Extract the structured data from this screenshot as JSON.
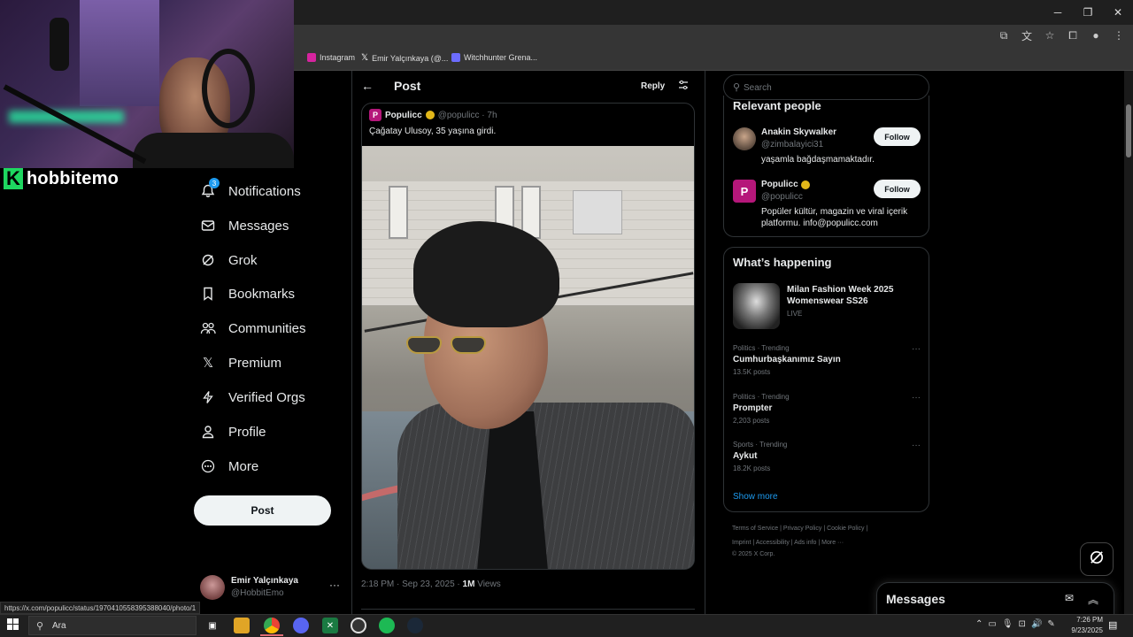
{
  "bookmarks": [
    {
      "label": "Instagram",
      "icon": "instagram-icon",
      "color": "#d6249f"
    },
    {
      "label": "Emir Yalçınkaya (@...",
      "icon": "x-logo-icon",
      "color": "#000000"
    },
    {
      "label": "Witchhunter Grena...",
      "icon": "shield-icon",
      "color": "#6c6cff"
    }
  ],
  "streamer": {
    "name": "hobbitemo",
    "logo_letter": "K"
  },
  "nav": {
    "notifications": "Notifications",
    "notifications_badge": "3",
    "messages": "Messages",
    "grok": "Grok",
    "bookmarks": "Bookmarks",
    "communities": "Communities",
    "premium": "Premium",
    "verified_orgs": "Verified Orgs",
    "profile": "Profile",
    "more": "More",
    "post_button": "Post"
  },
  "account": {
    "name": "Emir Yalçınkaya",
    "handle": "@HobbitEmo",
    "menu": "···"
  },
  "post_header": {
    "back": "←",
    "title": "Post",
    "reply": "Reply"
  },
  "quoted_post": {
    "avatar_letter": "P",
    "name": "Populicc",
    "handle_time": "@populicc · 7h",
    "text": "Çağatay Ulusoy, 35 yaşına girdi."
  },
  "post_meta": {
    "time": "2:18 PM · Sep 23, 2025 · ",
    "views_count": "1M",
    "views_label": " Views"
  },
  "search": {
    "placeholder": "Search"
  },
  "relevant": {
    "title": "Relevant people",
    "people": [
      {
        "name": "Anakin Skywalker",
        "handle": "@zimbalayici31",
        "bio": "yaşamla bağdaşmamaktadır.",
        "follow": "Follow"
      },
      {
        "name": "Populicc",
        "handle": "@populicc",
        "bio": "Popüler kültür, magazin ve viral içerik platformu. info@populicc.com",
        "follow": "Follow"
      }
    ]
  },
  "happening": {
    "title": "What’s happening",
    "featured": {
      "title": "Milan Fashion Week 2025 Womenswear SS26",
      "status": "LIVE"
    },
    "trends": [
      {
        "category": "Politics · Trending",
        "topic": "Cumhurbaşkanımız Sayın",
        "posts": "13.5K posts"
      },
      {
        "category": "Politics · Trending",
        "topic": "Prompter",
        "posts": "2,203 posts"
      },
      {
        "category": "Sports · Trending",
        "topic": "Aykut",
        "posts": "18.2K posts"
      }
    ],
    "show_more": "Show more"
  },
  "footer": {
    "line1": "Terms of Service  |  Privacy Policy  |  Cookie Policy  |",
    "line2": "Imprint  |  Accessibility  |  Ads info  |  More ···",
    "line3": "© 2025 X Corp."
  },
  "messages_drawer": {
    "title": "Messages"
  },
  "status_url": "https://x.com/populicc/status/1970410558395388040/photo/1",
  "taskbar": {
    "search_label": "Ara",
    "time": "7:26 PM",
    "date": "9/23/2025"
  },
  "colors": {
    "accent": "#1d9bf0",
    "brand_populicc": "#b5177a",
    "verified_gold": "#e2b719"
  }
}
